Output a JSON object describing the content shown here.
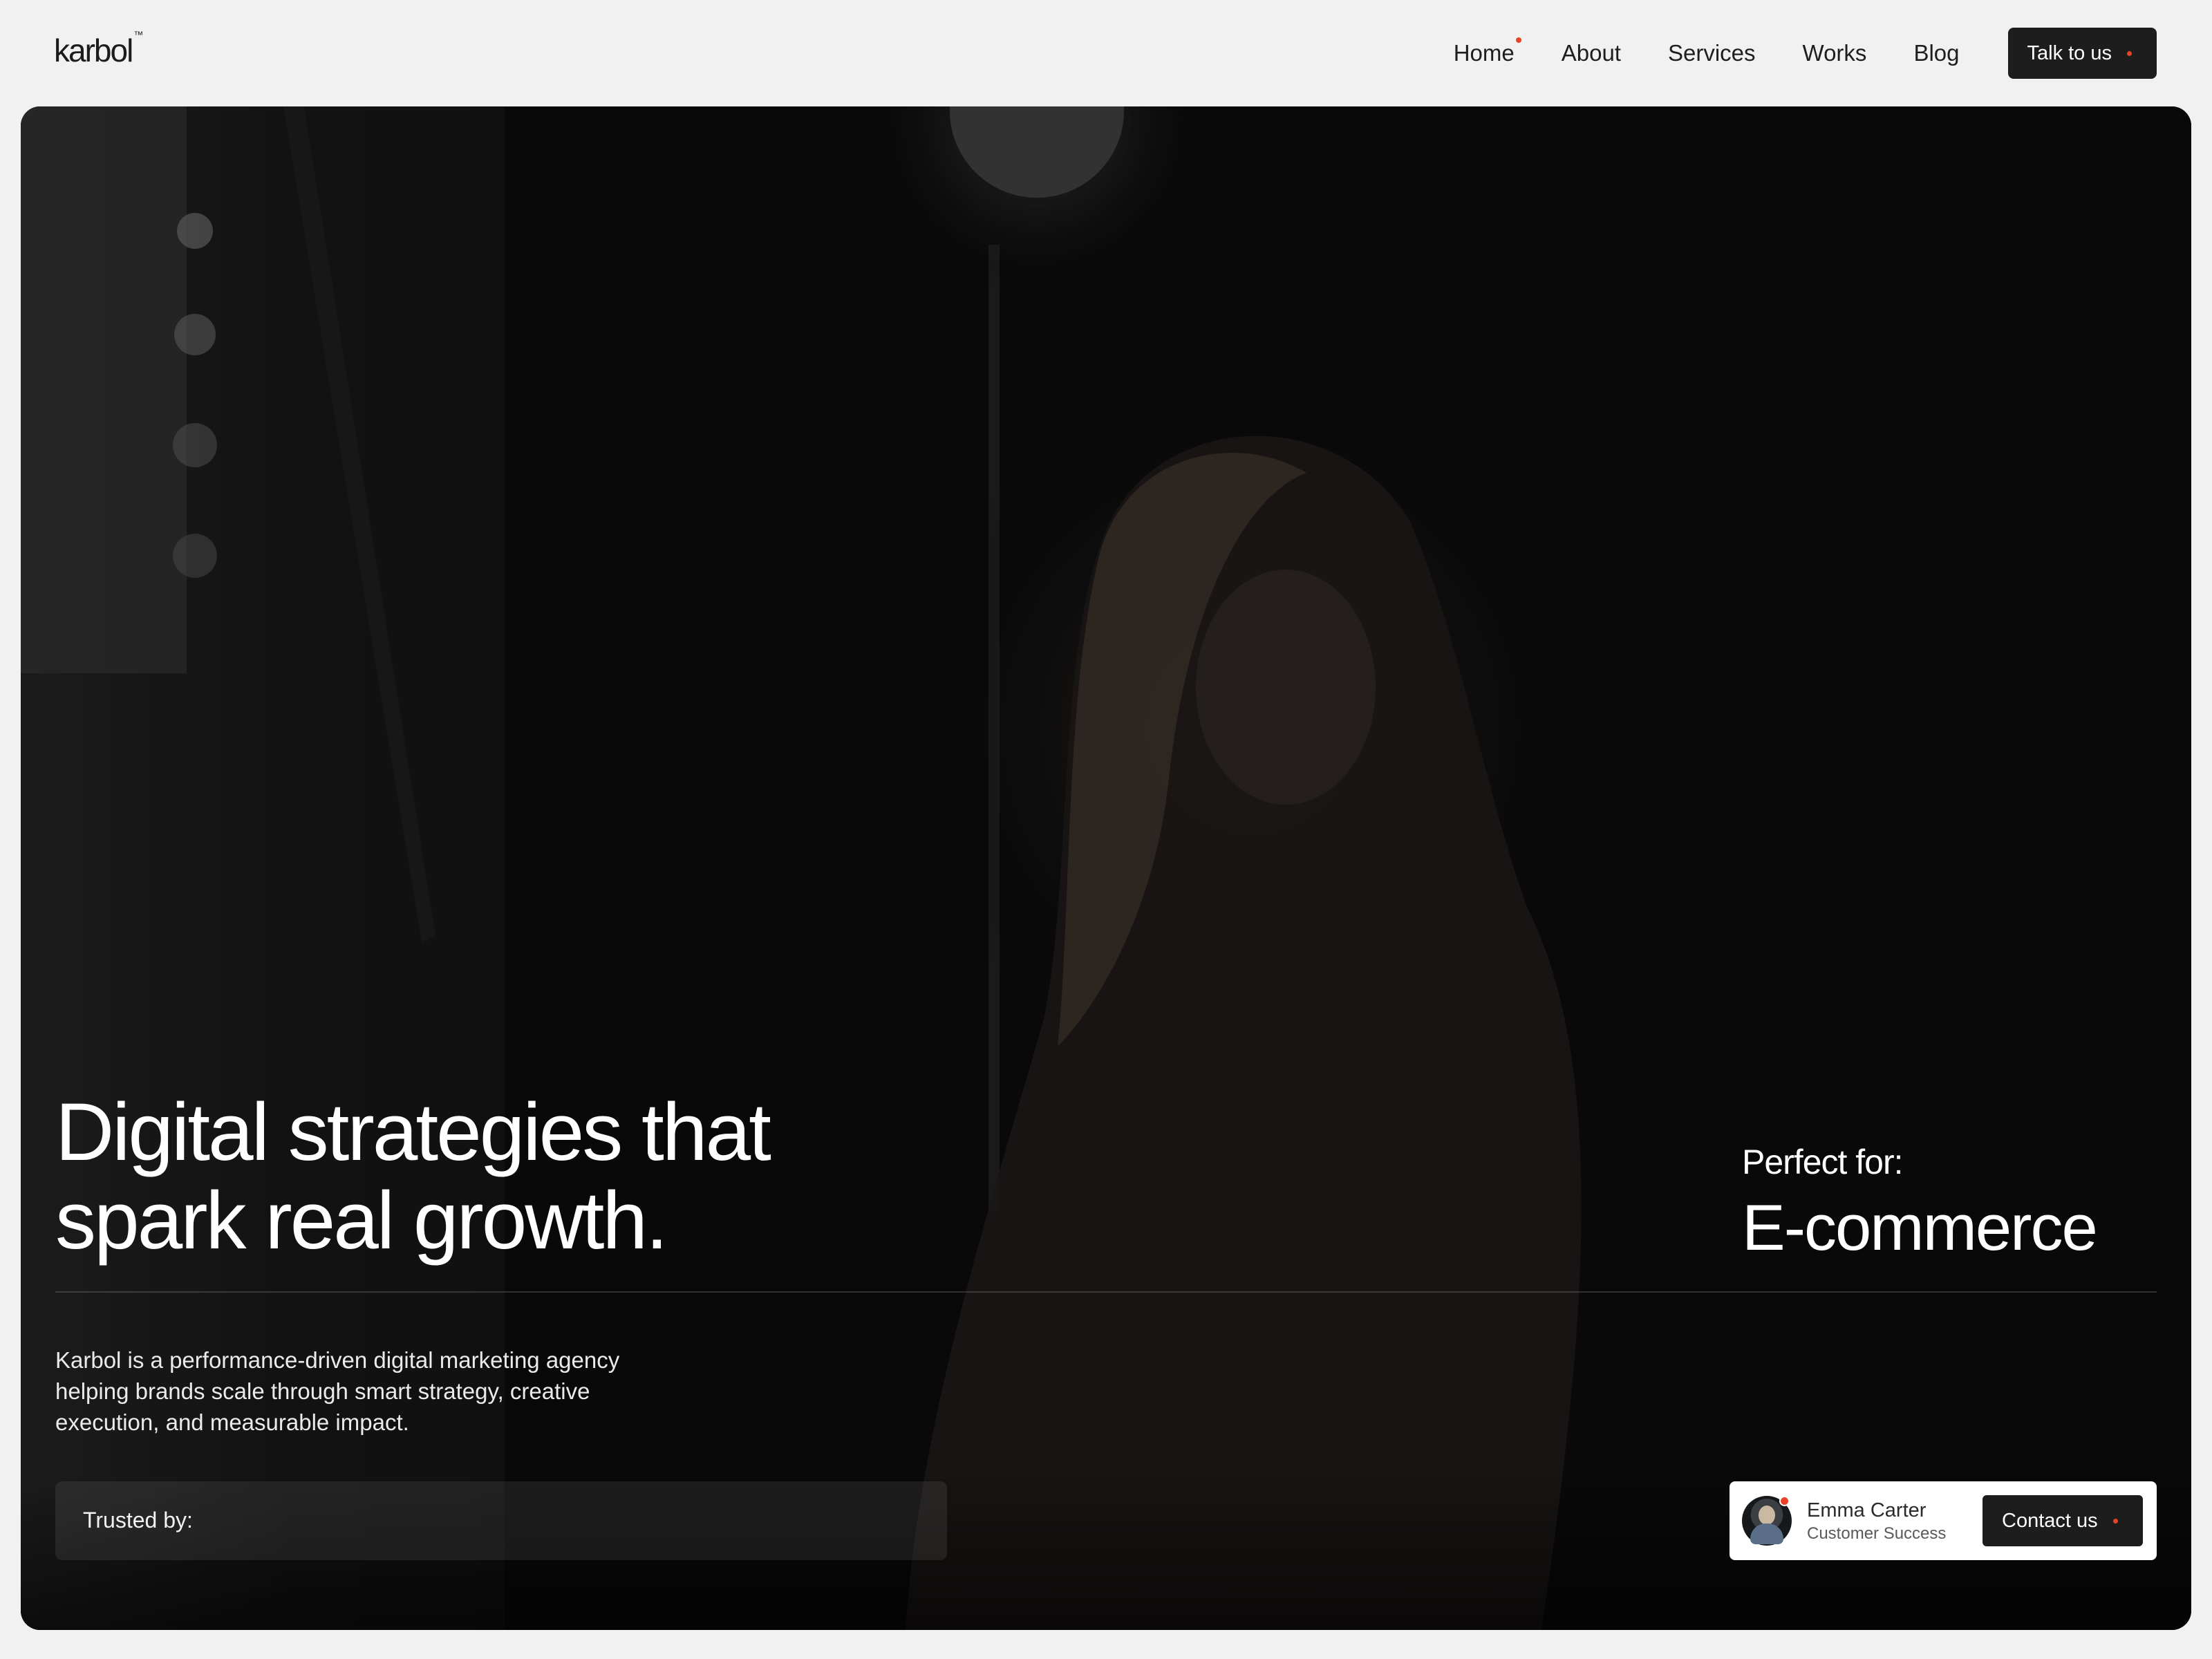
{
  "brand": {
    "logo_text": "karbol",
    "trademark": "™"
  },
  "nav": {
    "items": [
      {
        "label": "Home",
        "active": true
      },
      {
        "label": "About"
      },
      {
        "label": "Services"
      },
      {
        "label": "Works"
      },
      {
        "label": "Blog"
      }
    ],
    "cta_label": "Talk to us"
  },
  "hero": {
    "headline_line1": "Digital strategies that",
    "headline_line2": "spark real growth.",
    "perfect_for_label": "Perfect for:",
    "perfect_for_value": "E-commerce",
    "description": "Karbol is a performance-driven digital marketing agency helping brands scale through smart strategy, creative execution, and measurable impact.",
    "trusted_label": "Trusted by:",
    "background_image": "dark-photo-woman-sitting"
  },
  "contact_card": {
    "name": "Emma Carter",
    "role": "Customer Success",
    "button_label": "Contact us",
    "avatar_icon": "user-avatar-icon",
    "online_status": true
  },
  "colors": {
    "page_bg": "#f1f1f1",
    "dark": "#1d1d1d",
    "accent": "#e8432a",
    "hero_bg": "#0b0b0b",
    "white": "#ffffff"
  }
}
